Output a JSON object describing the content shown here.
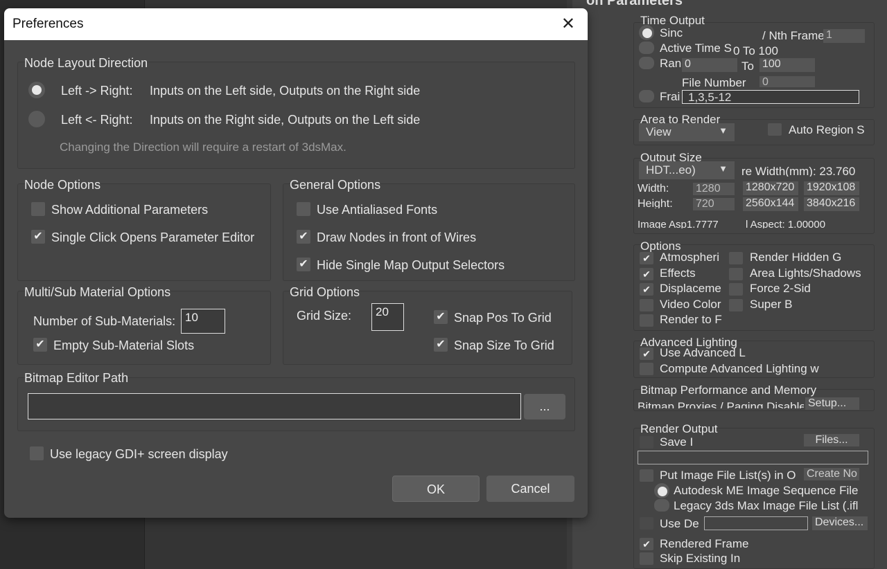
{
  "dialog": {
    "title": "Preferences",
    "node_layout": {
      "title": "Node Layout Direction",
      "options": [
        {
          "label": "Left -> Right:",
          "desc": "Inputs on the Left side, Outputs on the Right side",
          "selected": true
        },
        {
          "label": "Left <- Right:",
          "desc": "Inputs on the Right side, Outputs on the Left side",
          "selected": false
        }
      ],
      "note": "Changing the Direction will require a restart of 3dsMax."
    },
    "node_options": {
      "title": "Node Options",
      "items": [
        {
          "label": "Show Additional Parameters",
          "checked": false
        },
        {
          "label": "Single Click Opens Parameter Editor",
          "checked": true
        }
      ]
    },
    "general_options": {
      "title": "General Options",
      "items": [
        {
          "label": "Use Antialiased Fonts",
          "checked": false
        },
        {
          "label": "Draw Nodes in front of Wires",
          "checked": true
        },
        {
          "label": "Hide Single Map Output Selectors",
          "checked": true
        }
      ]
    },
    "multi_sub": {
      "title": "Multi/Sub Material Options",
      "count_label": "Number of Sub-Materials:",
      "count_value": "10",
      "empty_label": "Empty Sub-Material Slots",
      "empty_checked": true
    },
    "grid": {
      "title": "Grid Options",
      "size_label": "Grid Size:",
      "size_value": "20",
      "snap_pos": "Snap Pos To Grid",
      "snap_size": "Snap Size To Grid"
    },
    "bitmap": {
      "title": "Bitmap Editor Path",
      "path": "",
      "browse": "..."
    },
    "legacy_gdi": {
      "label": "Use legacy GDI+ screen display",
      "checked": false
    },
    "ok": "OK",
    "cancel": "Cancel",
    "check_glyph": "✔"
  },
  "panel": {
    "title": "on Parameters",
    "time_output": {
      "title": "Time Output",
      "single": "Sinc",
      "nth": "/ Nth Frame:",
      "nth_val": "1",
      "active": "Active Time S",
      "active_range": "0 To 100",
      "range": "Ran",
      "from": "0",
      "to_label": "To",
      "to": "100",
      "file_number": "File Number",
      "file_val": "0",
      "frames": "Frai",
      "frames_val": "1,3,5-12"
    },
    "area": {
      "title": "Area to Render",
      "view": "View",
      "auto_region": "Auto Region S"
    },
    "output_size": {
      "title": "Output Size",
      "preset": "HDT...eo)",
      "aperture": "re Width(mm): 23.760",
      "width_label": "Width:",
      "width": "1280",
      "height_label": "Height:",
      "height": "720",
      "presets": [
        "1280x720",
        "1920x108",
        "2560x144",
        "3840x216"
      ],
      "image_aspect": "Image Asp1.7777",
      "pixel_aspect": "l Aspect: 1.00000"
    },
    "options": {
      "title": "Options",
      "left": [
        {
          "label": "Atmospheri",
          "checked": true
        },
        {
          "label": "Effects",
          "checked": true
        },
        {
          "label": "Displaceme",
          "checked": true
        },
        {
          "label": "Video Color",
          "checked": false
        },
        {
          "label": "Render to F",
          "checked": false
        }
      ],
      "right": [
        {
          "label": "Render Hidden G",
          "checked": false
        },
        {
          "label": "Area Lights/Shadows",
          "checked": false
        },
        {
          "label": "Force 2-Sid",
          "checked": false
        },
        {
          "label": "Super B",
          "checked": false
        }
      ]
    },
    "adv_lighting": {
      "title": "Advanced Lighting",
      "use": "Use Advanced L",
      "compute": "Compute Advanced Lighting w"
    },
    "bitmap_perf": {
      "title": "Bitmap Performance and Memory",
      "status": "Bitmap Proxies / Paging Disable",
      "setup": "Setup..."
    },
    "render_output": {
      "title": "Render Output",
      "save": "Save I",
      "files": "Files...",
      "put_list": "Put Image File List(s) in O",
      "create": "Create No",
      "autodesk": "Autodesk ME Image Sequence File",
      "legacy": "Legacy 3ds Max Image File List (.ifl",
      "use_device": "Use De",
      "devices": "Devices...",
      "rendered_frame": "Rendered Frame",
      "skip": "Skip Existing In"
    }
  }
}
